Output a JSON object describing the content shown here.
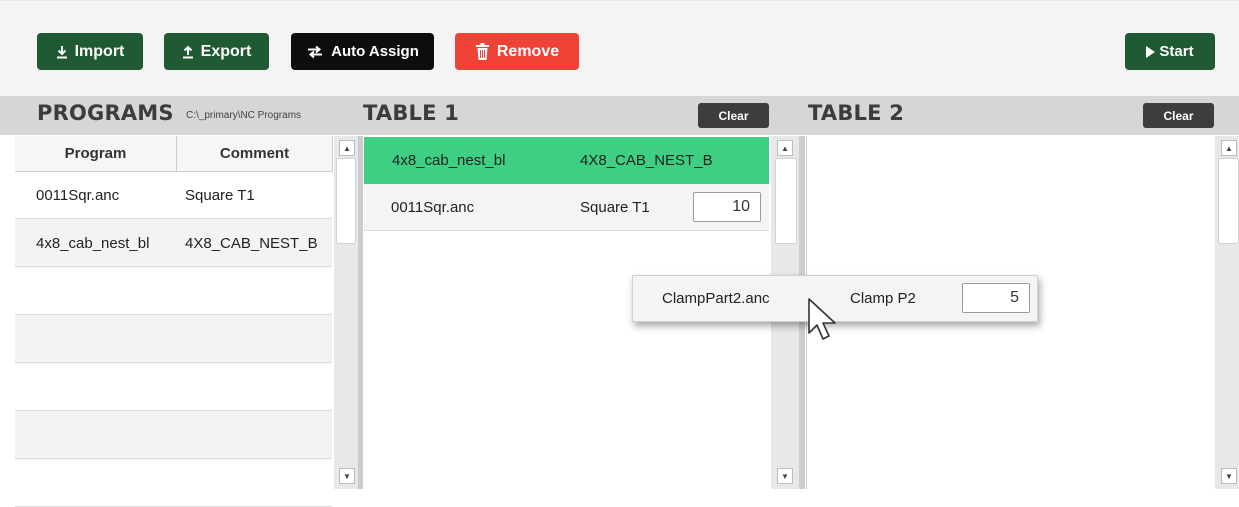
{
  "toolbar": {
    "import_label": "Import",
    "export_label": "Export",
    "auto_assign_label": "Auto Assign",
    "remove_label": "Remove",
    "start_label": "Start"
  },
  "programs": {
    "title": "PROGRAMS",
    "path": "C:\\_primary\\NC Programs",
    "columns": [
      "Program",
      "Comment"
    ],
    "rows": [
      {
        "program": "0011Sqr.anc",
        "comment": "Square T1"
      },
      {
        "program": "4x8_cab_nest_bl",
        "comment": "4X8_CAB_NEST_B"
      }
    ]
  },
  "table1": {
    "title": "TABLE 1",
    "clear_label": "Clear",
    "rows": [
      {
        "program": "4x8_cab_nest_bl",
        "comment": "4X8_CAB_NEST_B",
        "qty": ""
      },
      {
        "program": "0011Sqr.anc",
        "comment": "Square T1",
        "qty": "10"
      }
    ]
  },
  "table2": {
    "title": "TABLE 2",
    "clear_label": "Clear"
  },
  "drag_item": {
    "program": "ClampPart2.anc",
    "comment": "Clamp P2",
    "qty": "5"
  },
  "colors": {
    "green_button": "#1f5a32",
    "black_button": "#0d0d0d",
    "red_button": "#ef4338",
    "selected_row": "#3fcf83",
    "header_bar": "#d6d6d6"
  },
  "icons": {
    "import": "download-icon",
    "export": "upload-icon",
    "auto_assign": "swap-arrows-icon",
    "remove": "trash-icon",
    "start": "play-icon",
    "cursor": "mouse-pointer-icon"
  }
}
